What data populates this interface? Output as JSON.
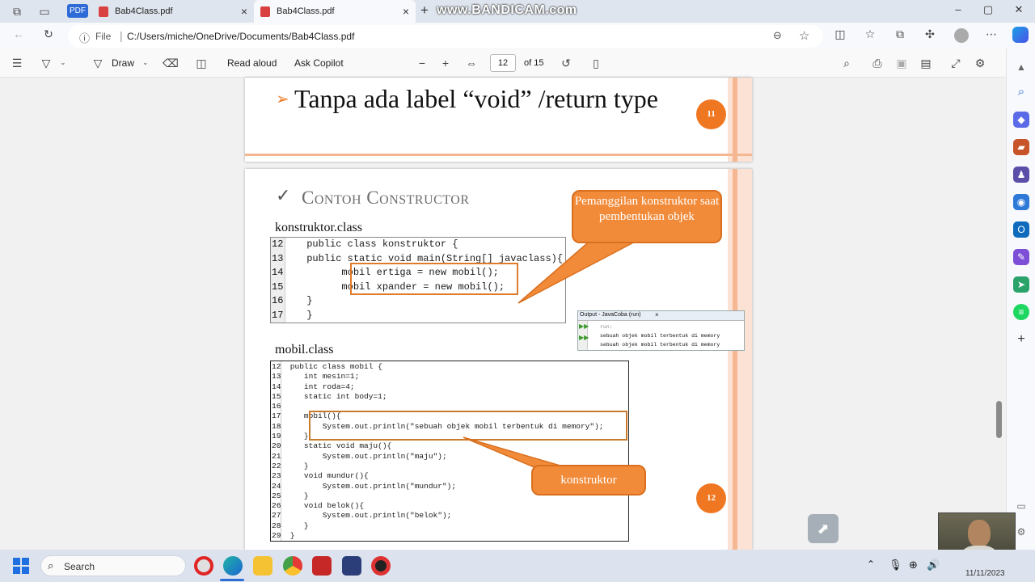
{
  "browser": {
    "tabs": [
      {
        "label": "Bab4Class.pdf",
        "badge": "PDF"
      },
      {
        "label": "Bab4Class.pdf",
        "active": true
      }
    ],
    "watermark": "www.BANDICAM.com",
    "address": {
      "scheme": "File",
      "url": "C:/Users/miche/OneDrive/Documents/Bab4Class.pdf"
    }
  },
  "pdf_toolbar": {
    "draw": "Draw",
    "read_aloud": "Read aloud",
    "ask_copilot": "Ask Copilot",
    "page": "12",
    "of_pages": "of 15"
  },
  "page11": {
    "bullet_text": "Tanpa ada label “void” /return type",
    "page_num": "11"
  },
  "page12": {
    "heading": "Contoh Constructor",
    "label_konstruktor": "konstruktor.class",
    "label_mobil": "mobil.class",
    "callout_top": "Pemanggilan konstruktor saat pembentukan objek",
    "callout_bottom": "konstruktor",
    "page_num": "12",
    "code_konstruktor": [
      {
        "n": "12",
        "t": "   public class konstruktor {"
      },
      {
        "n": "13",
        "t": "   public static void main(String[] javaclass){"
      },
      {
        "n": "14",
        "t": "         mobil ertiga = new mobil();"
      },
      {
        "n": "15",
        "t": "         mobil xpander = new mobil();"
      },
      {
        "n": "16",
        "t": "   }"
      },
      {
        "n": "17",
        "t": "   }"
      }
    ],
    "code_mobil": [
      {
        "n": "12",
        "t": " public class mobil {"
      },
      {
        "n": "13",
        "t": "    int mesin=1;"
      },
      {
        "n": "14",
        "t": "    int roda=4;"
      },
      {
        "n": "15",
        "t": "    static int body=1;"
      },
      {
        "n": "16",
        "t": ""
      },
      {
        "n": "17",
        "t": "    mobil(){"
      },
      {
        "n": "18",
        "t": "        System.out.println(\"sebuah objek mobil terbentuk di memory\");"
      },
      {
        "n": "19",
        "t": "    }"
      },
      {
        "n": "20",
        "t": "    static void maju(){"
      },
      {
        "n": "21",
        "t": "        System.out.println(\"maju\");"
      },
      {
        "n": "22",
        "t": "    }"
      },
      {
        "n": "23",
        "t": "    void mundur(){"
      },
      {
        "n": "24",
        "t": "        System.out.println(\"mundur\");"
      },
      {
        "n": "25",
        "t": "    }"
      },
      {
        "n": "26",
        "t": "    void belok(){"
      },
      {
        "n": "27",
        "t": "        System.out.println(\"belok\");"
      },
      {
        "n": "28",
        "t": "    }"
      },
      {
        "n": "29",
        "t": " }"
      }
    ],
    "output": {
      "title": "Output - JavaCoba (run)",
      "lines": [
        "run:",
        "sebuah objek mobil terbentuk di memory",
        "sebuah objek mobil terbentuk di memory"
      ]
    }
  },
  "taskbar": {
    "search_placeholder": "Search",
    "date": "11/11/2023"
  },
  "colors": {
    "accent_orange": "#ef7722",
    "callout": "#f18b3a",
    "keyword": "#1c3fc7"
  }
}
